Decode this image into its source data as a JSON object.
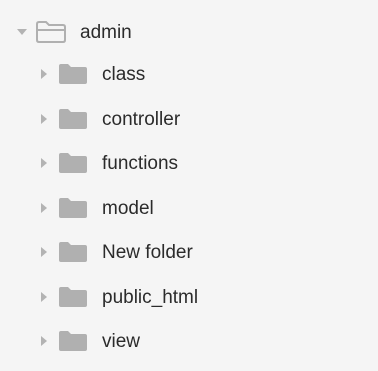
{
  "tree": {
    "root": {
      "label": "admin",
      "icon": "folder-open-icon",
      "expanded": true
    },
    "children": [
      {
        "label": "class",
        "icon": "folder-icon",
        "expanded": false
      },
      {
        "label": "controller",
        "icon": "folder-icon",
        "expanded": false
      },
      {
        "label": "functions",
        "icon": "folder-icon",
        "expanded": false
      },
      {
        "label": "model",
        "icon": "folder-icon",
        "expanded": false
      },
      {
        "label": "New folder",
        "icon": "folder-icon",
        "expanded": false
      },
      {
        "label": "public_html",
        "icon": "folder-icon",
        "expanded": false
      },
      {
        "label": "view",
        "icon": "folder-icon",
        "expanded": false
      }
    ],
    "colors": {
      "background": "#f5f5f5",
      "folder_fill": "#b0b0b0",
      "caret": "#b3b3b3",
      "text": "#2b2b2b"
    }
  }
}
